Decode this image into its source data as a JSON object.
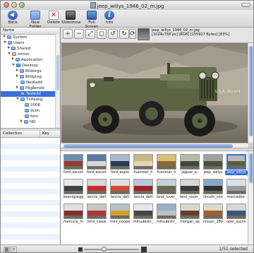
{
  "window": {
    "title": "jeep_willys_1946_02_m.jpg"
  },
  "toolbar": {
    "back": "Back",
    "new_folder": "New Folder",
    "delete": "Delete",
    "slideshow": "Slideshow",
    "full_screen": "Full Screen",
    "info": "Info"
  },
  "sidebar": {
    "header": "Name",
    "tree": [
      {
        "label": "System",
        "indent": 1,
        "expander": "right",
        "icon": "folder"
      },
      {
        "label": "Users",
        "indent": 1,
        "expander": "down",
        "icon": "folder"
      },
      {
        "label": "Shared",
        "indent": 2,
        "expander": "right",
        "icon": "folder"
      },
      {
        "label": "simon",
        "indent": 2,
        "expander": "down",
        "icon": "home"
      },
      {
        "label": "Application",
        "indent": 3,
        "expander": "right",
        "icon": "folder"
      },
      {
        "label": "Desktop",
        "indent": 3,
        "expander": "down",
        "icon": "desktop"
      },
      {
        "label": "Bildorga",
        "indent": 4,
        "expander": "right",
        "icon": "folder"
      },
      {
        "label": "Bildprog",
        "indent": 4,
        "expander": "right",
        "icon": "folder"
      },
      {
        "label": "Nedladd",
        "indent": 4,
        "expander": "none",
        "icon": "folder"
      },
      {
        "label": "Pågående",
        "indent": 4,
        "expander": "right",
        "icon": "folder"
      },
      {
        "label": "Testbild",
        "indent": 4,
        "expander": "none",
        "icon": "folder",
        "selected": true
      },
      {
        "label": "Tvifaalig",
        "indent": 4,
        "expander": "down",
        "icon": "folder"
      },
      {
        "label": "2006",
        "indent": 5,
        "expander": "none",
        "icon": "folder"
      },
      {
        "label": "dcim",
        "indent": 5,
        "expander": "none",
        "icon": "folder"
      },
      {
        "label": "foto",
        "indent": 5,
        "expander": "none",
        "icon": "folder"
      },
      {
        "label": "HD",
        "indent": 5,
        "expander": "right",
        "icon": "folder"
      }
    ],
    "props_headers": {
      "collection": "Collection",
      "key": "Key"
    }
  },
  "viewer": {
    "info_line1": "jeep_willys_1946_02_m.jpg",
    "info_line2": "[1024x768 px] [RGB] [155927 Bytes] [83%]",
    "tools": [
      "zoom-in",
      "zoom-out",
      "zoom-fit",
      "zoom-actual",
      "rotate-left",
      "rotate-right",
      "refresh"
    ],
    "photo_plate": "U.S.A. 361474"
  },
  "thumbnails": [
    {
      "label": "ford_escort",
      "colors": [
        "#6b8fb0",
        "#9a3a2a"
      ]
    },
    {
      "label": "ford_escort",
      "colors": [
        "#5c7aa0",
        "#d8d8d8"
      ]
    },
    {
      "label": "ford_explo",
      "colors": [
        "#a8b8c8",
        "#2a3a5a"
      ]
    },
    {
      "label": "hummer_h",
      "colors": [
        "#c8b888",
        "#e2d8b0"
      ]
    },
    {
      "label": "hummer_h",
      "colors": [
        "#d8c078",
        "#8a6a30"
      ]
    },
    {
      "label": "jaguar_e-",
      "colors": [
        "#b8b8a8",
        "#3a4a3a"
      ]
    },
    {
      "label": "jeep_willys",
      "colors": [
        "#a0a0a0",
        "#4a5238"
      ]
    },
    {
      "label": "jeep_willys",
      "colors": [
        "#b8b8b8",
        "#56603e"
      ],
      "selected": true
    },
    {
      "label": "koenigsegg",
      "colors": [
        "#e8e8e8",
        "#404040"
      ]
    },
    {
      "label": "lancia_delt",
      "colors": [
        "#d8d8d8",
        "#c03028"
      ]
    },
    {
      "label": "lancia_delt",
      "colors": [
        "#e0e0e0",
        "#d04a30"
      ]
    },
    {
      "label": "lancia_delt",
      "colors": [
        "#b8c8d8",
        "#a02020"
      ]
    },
    {
      "label": "land_rover_",
      "colors": [
        "#c8d0d8",
        "#6a6a50"
      ]
    },
    {
      "label": "land_rover_",
      "colors": [
        "#d8d8d8",
        "#3a3a3a"
      ]
    },
    {
      "label": "lincoln_con",
      "colors": [
        "#88a8c8",
        "#303030"
      ]
    },
    {
      "label": "mercedes-",
      "colors": [
        "#d8e0e8",
        "#9a9a9a"
      ]
    },
    {
      "label": "mercury_m",
      "colors": [
        "#e0e0e0",
        "#8a2a2a"
      ]
    },
    {
      "label": "mini_classi",
      "colors": [
        "#c8c8c0",
        "#b03838"
      ]
    },
    {
      "label": "mini_coope",
      "colors": [
        "#b8c0c8",
        "#d0a020"
      ]
    },
    {
      "label": "mitsubishi_",
      "colors": [
        "#e8e8e8",
        "#484848"
      ]
    },
    {
      "label": "mitsubishi_",
      "colors": [
        "#98b0c8",
        "#c0c0c0"
      ]
    },
    {
      "label": "morgan_ae",
      "colors": [
        "#d8d8c8",
        "#6a3a2a"
      ]
    },
    {
      "label": "nissan_280",
      "colors": [
        "#e0d8c8",
        "#a06030"
      ]
    },
    {
      "label": "opel_ascon",
      "colors": [
        "#d8d8d8",
        "#385880"
      ]
    }
  ],
  "status": {
    "selection": "1/51 selected"
  }
}
